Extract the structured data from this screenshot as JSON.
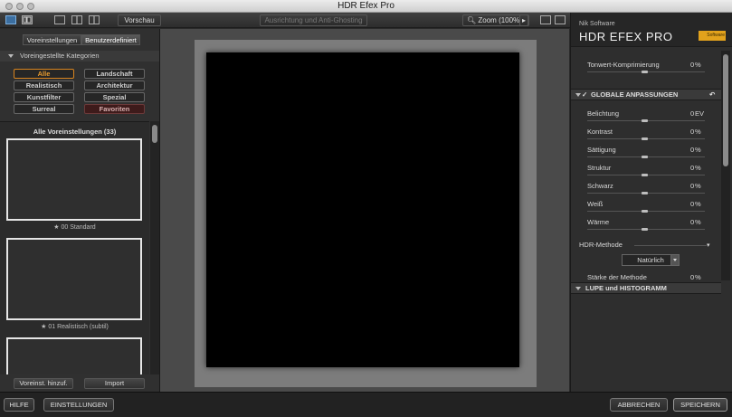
{
  "window": {
    "title": "HDR Efex Pro"
  },
  "toolbar": {
    "preview_label": "Vorschau",
    "view_toggle_label": "Ausrichtung und Anti-Ghosting",
    "zoom_label": "Zoom (100%)"
  },
  "left_panel": {
    "tabs": [
      "Voreinstellungen",
      "Benutzerdefiniert"
    ],
    "categories_header": "Voreingestellte Kategorien",
    "categories": [
      "Alle",
      "Landschaft",
      "Realistisch",
      "Architektur",
      "Kunstfilter",
      "Spezial",
      "Surreal",
      "Favoriten"
    ],
    "presets_title": "Alle Voreinstellungen (33)",
    "preset_items": [
      "00 Standard",
      "01 Realistisch (subtil)"
    ],
    "add_preset_label": "Voreinst. hinzuf.",
    "import_label": "Import"
  },
  "right_panel": {
    "brand_small": "Nik Software",
    "brand_big": "HDR EFEX PRO",
    "logo_text": "Software",
    "tone_compression": {
      "label": "Tonwert-Komprimierung",
      "value": "0",
      "unit": "%"
    },
    "global_header": "GLOBALE ANPASSUNGEN",
    "adjustments": [
      {
        "label": "Belichtung",
        "value": "0",
        "unit": "EV"
      },
      {
        "label": "Kontrast",
        "value": "0",
        "unit": "%"
      },
      {
        "label": "Sättigung",
        "value": "0",
        "unit": "%"
      },
      {
        "label": "Struktur",
        "value": "0",
        "unit": "%"
      },
      {
        "label": "Schwarz",
        "value": "0",
        "unit": "%"
      },
      {
        "label": "Weiß",
        "value": "0",
        "unit": "%"
      },
      {
        "label": "Wärme",
        "value": "0",
        "unit": "%"
      }
    ],
    "hdr_method_label": "HDR-Methode",
    "hdr_method_value": "Natürlich",
    "method_strength": {
      "label": "Stärke der Methode",
      "value": "0",
      "unit": "%"
    },
    "loupe_header": "LUPE und HISTOGRAMM"
  },
  "bottom_bar": {
    "help_label": "HILFE",
    "settings_label": "EINSTELLUNGEN",
    "cancel_label": "ABBRECHEN",
    "save_label": "SPEICHERN"
  },
  "colors": {
    "accent_orange": "#e79a2e",
    "favorite_red": "#3e1b1b",
    "logo_yellow": "#e2a21c"
  }
}
